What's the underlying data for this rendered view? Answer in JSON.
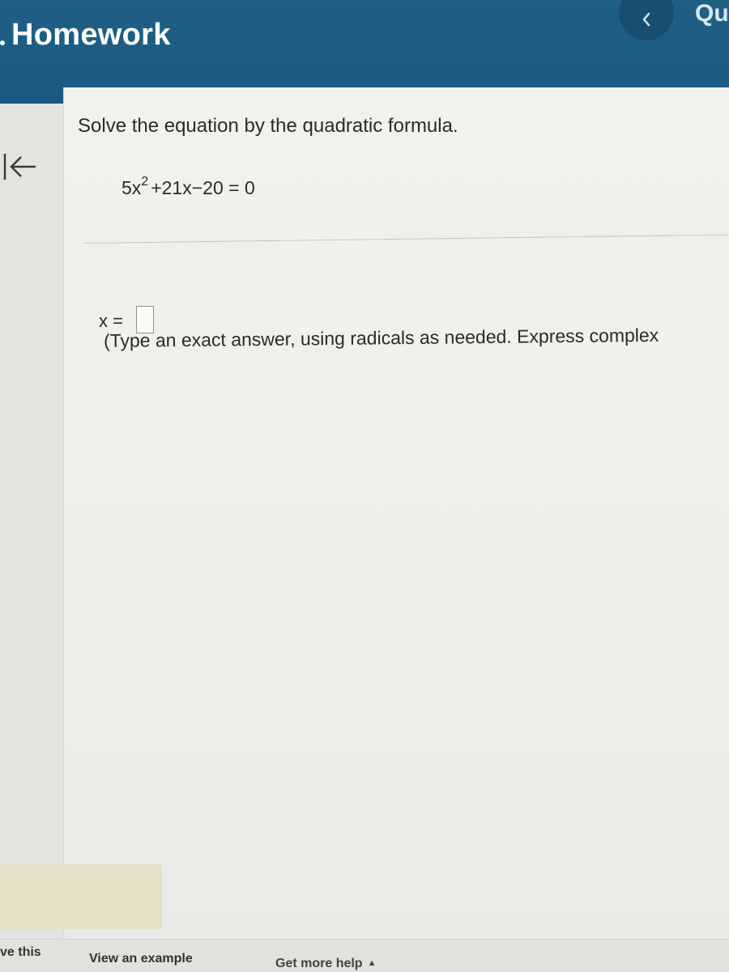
{
  "header": {
    "title": "Homework",
    "right_label": "Qu"
  },
  "question": {
    "prompt": "Solve the equation by the quadratic formula.",
    "equation": {
      "lead": "5x",
      "exponent": "2",
      "rest": "+21x−20 = 0"
    }
  },
  "answer": {
    "label": "x =",
    "value": "",
    "instructions": "(Type an exact answer, using radicals as needed. Express complex"
  },
  "footer": {
    "save_label": "ve this",
    "example_label": "View an example",
    "help_label": "Get more help",
    "help_caret": "▲"
  },
  "colors": {
    "header_bg": "#1f5f86",
    "content_bg": "#f1f2ee"
  },
  "icons": {
    "back": "arrow-left-icon",
    "prev": "chevron-left-icon"
  }
}
